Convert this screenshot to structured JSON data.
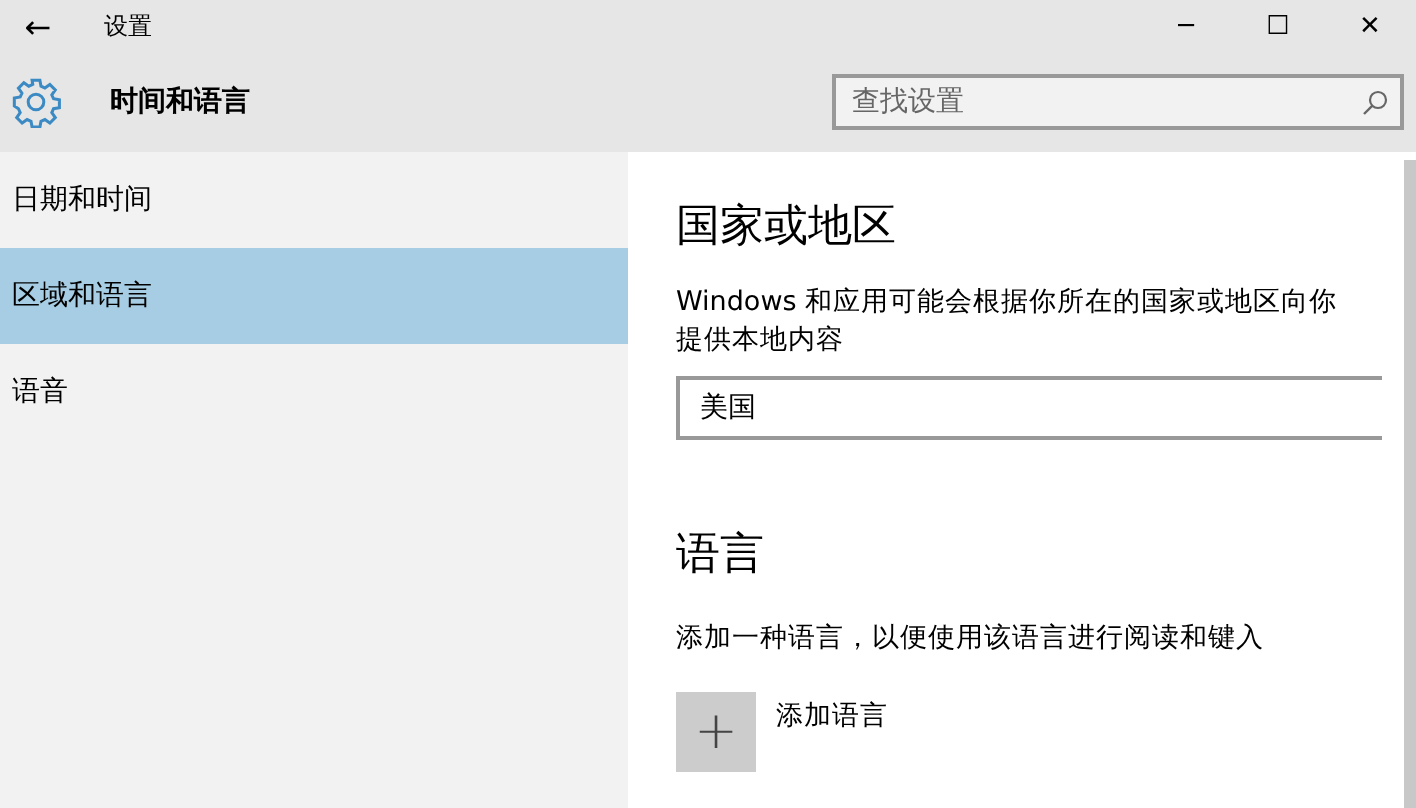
{
  "window": {
    "title": "设置",
    "back": "←",
    "controls": [
      "─",
      "☐",
      "✕"
    ]
  },
  "header": {
    "title": "时间和语言",
    "search": {
      "placeholder": "查找设置"
    }
  },
  "sidebar": {
    "items": [
      {
        "label": "日期和时间",
        "selected": false
      },
      {
        "label": "区域和语言",
        "selected": true
      },
      {
        "label": "语音",
        "selected": false
      }
    ]
  },
  "content": {
    "region": {
      "heading": "国家或地区",
      "description": "Windows 和应用可能会根据你所在的国家或地区向你提供本地内容",
      "value": "美国"
    },
    "language": {
      "heading": "语言",
      "description": "添加一种语言，以便使用该语言进行阅读和键入",
      "add_icon": "+",
      "add_label": "添加语言"
    }
  }
}
